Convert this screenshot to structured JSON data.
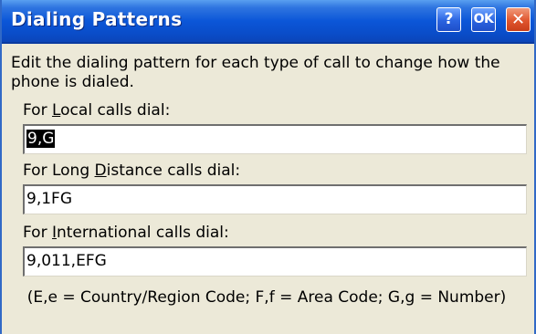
{
  "window": {
    "title": "Dialing Patterns",
    "buttons": {
      "help": "?",
      "ok": "OK",
      "close": "✕"
    }
  },
  "intro": "Edit the dialing pattern for each type of call to change how the phone is dialed.",
  "fields": {
    "local": {
      "label_pre": "For ",
      "label_key": "L",
      "label_post": "ocal calls dial:",
      "value": "9,G"
    },
    "long_distance": {
      "label_pre": "For Long ",
      "label_key": "D",
      "label_post": "istance calls dial:",
      "value": "9,1FG"
    },
    "international": {
      "label_pre": "For ",
      "label_key": "I",
      "label_post": "nternational calls dial:",
      "value": "9,011,EFG"
    }
  },
  "note": "(E,e = Country/Region Code; F,f = Area Code; G,g = Number)"
}
